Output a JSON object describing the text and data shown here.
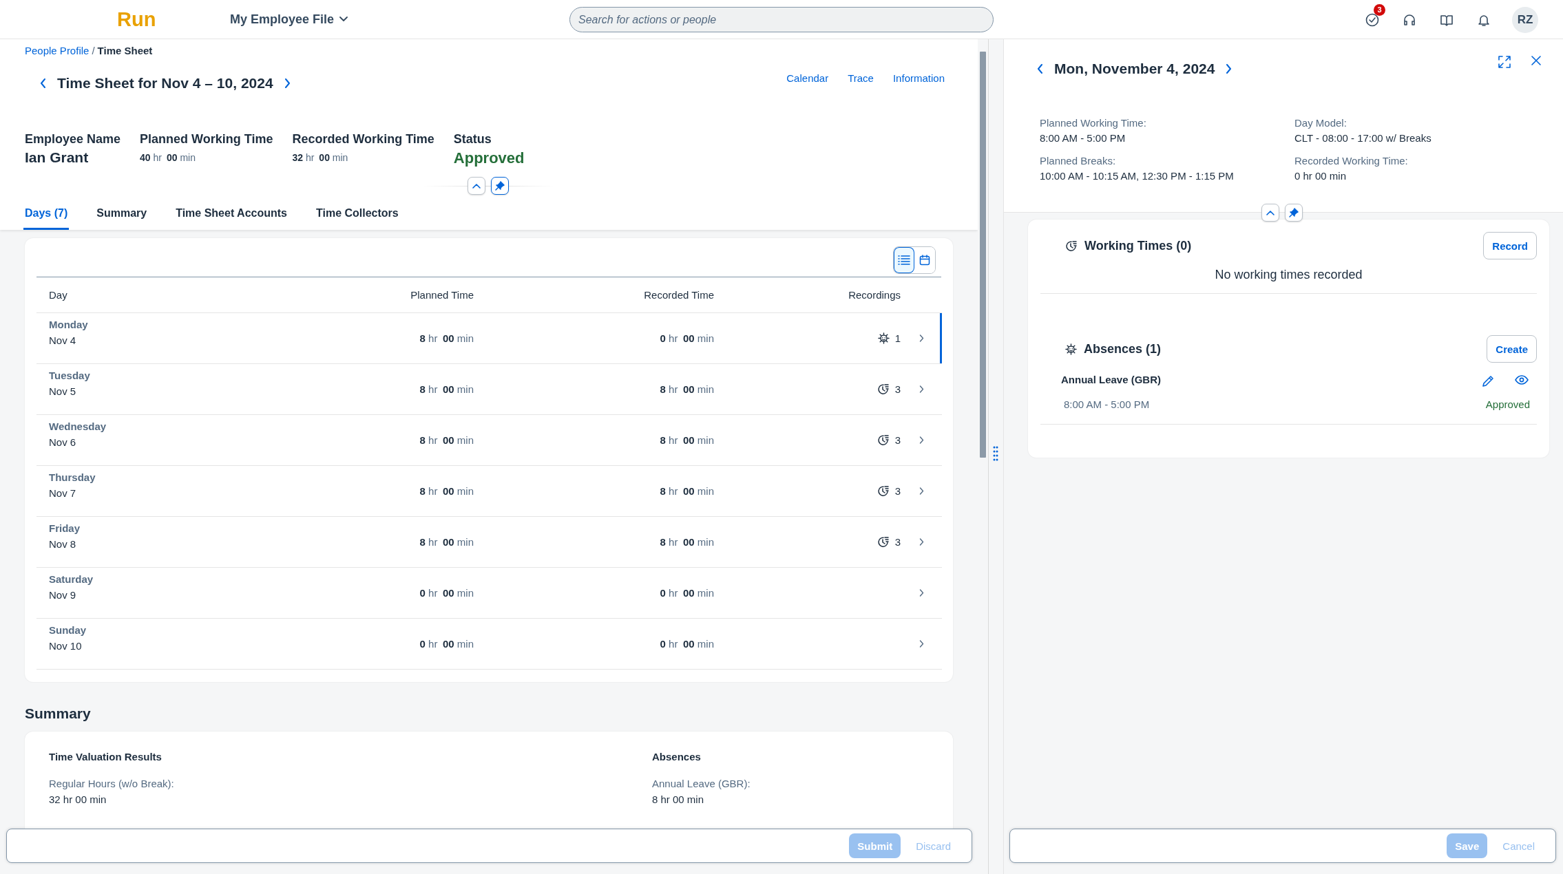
{
  "shell": {
    "logo": "Run",
    "nav_menu": "My Employee File",
    "search": {
      "placeholder": "Search for actions or people"
    },
    "tasks_badge": "3",
    "avatar": "RZ"
  },
  "breadcrumb": {
    "separator": "/",
    "items": [
      {
        "label": "People Profile",
        "current": false
      },
      {
        "label": "Time Sheet",
        "current": true
      }
    ]
  },
  "header": {
    "title": "Time Sheet for Nov 4 – 10, 2024",
    "actions": [
      "Calendar",
      "Trace",
      "Information"
    ],
    "attributes": [
      {
        "kind": "name",
        "label": "Employee Name",
        "value": "Ian Grant"
      },
      {
        "kind": "duration",
        "label": "Planned Working Time",
        "value": {
          "hours": "40",
          "hours_unit": "hr",
          "minutes": "00",
          "minutes_unit": "min"
        }
      },
      {
        "kind": "duration",
        "label": "Recorded Working Time",
        "value": {
          "hours": "32",
          "hours_unit": "hr",
          "minutes": "00",
          "minutes_unit": "min"
        }
      },
      {
        "kind": "status",
        "label": "Status",
        "value": "Approved"
      }
    ]
  },
  "tabs": [
    {
      "label": "Days (7)",
      "selected": true
    },
    {
      "label": "Summary",
      "selected": false
    },
    {
      "label": "Time Sheet Accounts",
      "selected": false
    },
    {
      "label": "Time Collectors",
      "selected": false
    }
  ],
  "view_toggle": [
    {
      "kind": "list",
      "selected": true
    },
    {
      "kind": "calendar",
      "selected": false
    }
  ],
  "table": {
    "columns": [
      "Day",
      "Planned Time",
      "Recorded Time",
      "Recordings"
    ],
    "rows": [
      {
        "day": "Monday",
        "date": "Nov 4",
        "planned": {
          "hours": "8",
          "hours_unit": "hr",
          "minutes": "00",
          "minutes_unit": "min"
        },
        "recorded": {
          "hours": "0",
          "hours_unit": "hr",
          "minutes": "00",
          "minutes_unit": "min"
        },
        "recordings": {
          "kind": "absence",
          "count": "1"
        },
        "selected": true
      },
      {
        "day": "Tuesday",
        "date": "Nov 5",
        "planned": {
          "hours": "8",
          "hours_unit": "hr",
          "minutes": "00",
          "minutes_unit": "min"
        },
        "recorded": {
          "hours": "8",
          "hours_unit": "hr",
          "minutes": "00",
          "minutes_unit": "min"
        },
        "recordings": {
          "kind": "working",
          "count": "3"
        },
        "selected": false
      },
      {
        "day": "Wednesday",
        "date": "Nov 6",
        "planned": {
          "hours": "8",
          "hours_unit": "hr",
          "minutes": "00",
          "minutes_unit": "min"
        },
        "recorded": {
          "hours": "8",
          "hours_unit": "hr",
          "minutes": "00",
          "minutes_unit": "min"
        },
        "recordings": {
          "kind": "working",
          "count": "3"
        },
        "selected": false
      },
      {
        "day": "Thursday",
        "date": "Nov 7",
        "planned": {
          "hours": "8",
          "hours_unit": "hr",
          "minutes": "00",
          "minutes_unit": "min"
        },
        "recorded": {
          "hours": "8",
          "hours_unit": "hr",
          "minutes": "00",
          "minutes_unit": "min"
        },
        "recordings": {
          "kind": "working",
          "count": "3"
        },
        "selected": false
      },
      {
        "day": "Friday",
        "date": "Nov 8",
        "planned": {
          "hours": "8",
          "hours_unit": "hr",
          "minutes": "00",
          "minutes_unit": "min"
        },
        "recorded": {
          "hours": "8",
          "hours_unit": "hr",
          "minutes": "00",
          "minutes_unit": "min"
        },
        "recordings": {
          "kind": "working",
          "count": "3"
        },
        "selected": false
      },
      {
        "day": "Saturday",
        "date": "Nov 9",
        "planned": {
          "hours": "0",
          "hours_unit": "hr",
          "minutes": "00",
          "minutes_unit": "min"
        },
        "recorded": {
          "hours": "0",
          "hours_unit": "hr",
          "minutes": "00",
          "minutes_unit": "min"
        },
        "selected": false
      },
      {
        "day": "Sunday",
        "date": "Nov 10",
        "planned": {
          "hours": "0",
          "hours_unit": "hr",
          "minutes": "00",
          "minutes_unit": "min"
        },
        "recorded": {
          "hours": "0",
          "hours_unit": "hr",
          "minutes": "00",
          "minutes_unit": "min"
        },
        "selected": false
      }
    ]
  },
  "summary": {
    "title": "Summary",
    "groups": [
      {
        "title": "Time Valuation Results",
        "items": [
          {
            "label": "Regular Hours (w/o Break):",
            "value": "32 hr 00 min"
          }
        ]
      },
      {
        "title": "Absences",
        "items": [
          {
            "label": "Annual Leave (GBR):",
            "value": "8 hr 00 min"
          }
        ]
      }
    ]
  },
  "footer": {
    "buttons": [
      {
        "label": "Submit",
        "kind": "primary",
        "disabled": true
      },
      {
        "label": "Discard",
        "kind": "transparent",
        "disabled": true
      }
    ]
  },
  "detail": {
    "title": "Mon, November 4, 2024",
    "fields": [
      {
        "label": "Planned Working Time:",
        "value": "8:00 AM - 5:00 PM"
      },
      {
        "label": "Day Model:",
        "value": "CLT - 08:00 - 17:00 w/ Breaks"
      },
      {
        "label": "Planned Breaks:",
        "value": "10:00 AM - 10:15 AM, 12:30 PM - 1:15 PM"
      },
      {
        "label": "Recorded Working Time:",
        "value": "0 hr 00 min"
      }
    ],
    "working_times": {
      "title": "Working Times (0)",
      "button": "Record",
      "empty_text": "No working times recorded"
    },
    "absences": {
      "title": "Absences (1)",
      "button": "Create",
      "items": [
        {
          "name": "Annual Leave (GBR)",
          "time": "8:00 AM - 5:00 PM",
          "status": "Approved"
        }
      ]
    },
    "footer": {
      "buttons": [
        {
          "label": "Save",
          "kind": "primary",
          "disabled": true
        },
        {
          "label": "Cancel",
          "kind": "transparent",
          "disabled": true
        }
      ]
    }
  }
}
